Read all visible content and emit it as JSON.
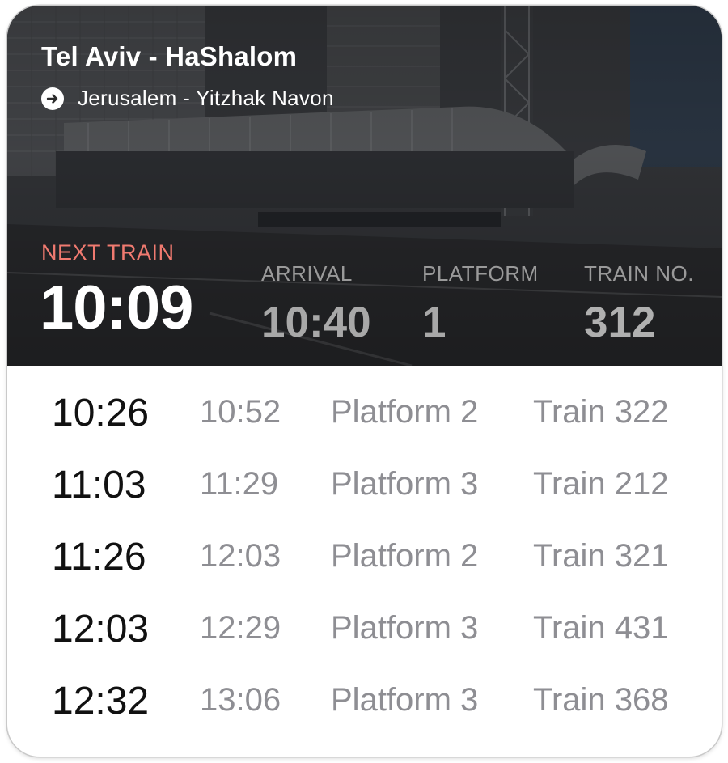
{
  "header": {
    "station": "Tel Aviv - HaShalom",
    "destination": "Jerusalem - Yitzhak Navon",
    "destination_icon": "arrow-right-circle-icon"
  },
  "next_train": {
    "label": "NEXT TRAIN",
    "departure": "10:09",
    "arrival_label": "ARRIVAL",
    "arrival": "10:40",
    "platform_label": "PLATFORM",
    "platform": "1",
    "train_label": "TRAIN NO.",
    "train": "312"
  },
  "departures": [
    {
      "departure": "10:26",
      "arrival": "10:52",
      "platform": "Platform 2",
      "train": "Train 322"
    },
    {
      "departure": "11:03",
      "arrival": "11:29",
      "platform": "Platform 3",
      "train": "Train 212"
    },
    {
      "departure": "11:26",
      "arrival": "12:03",
      "platform": "Platform 2",
      "train": "Train 321"
    },
    {
      "departure": "12:03",
      "arrival": "12:29",
      "platform": "Platform 3",
      "train": "Train 431"
    },
    {
      "departure": "12:32",
      "arrival": "13:06",
      "platform": "Platform 3",
      "train": "Train 368"
    }
  ],
  "colors": {
    "next_train_label": "#f07a70",
    "primary_text": "#111111",
    "secondary_text": "#8e8e93"
  }
}
